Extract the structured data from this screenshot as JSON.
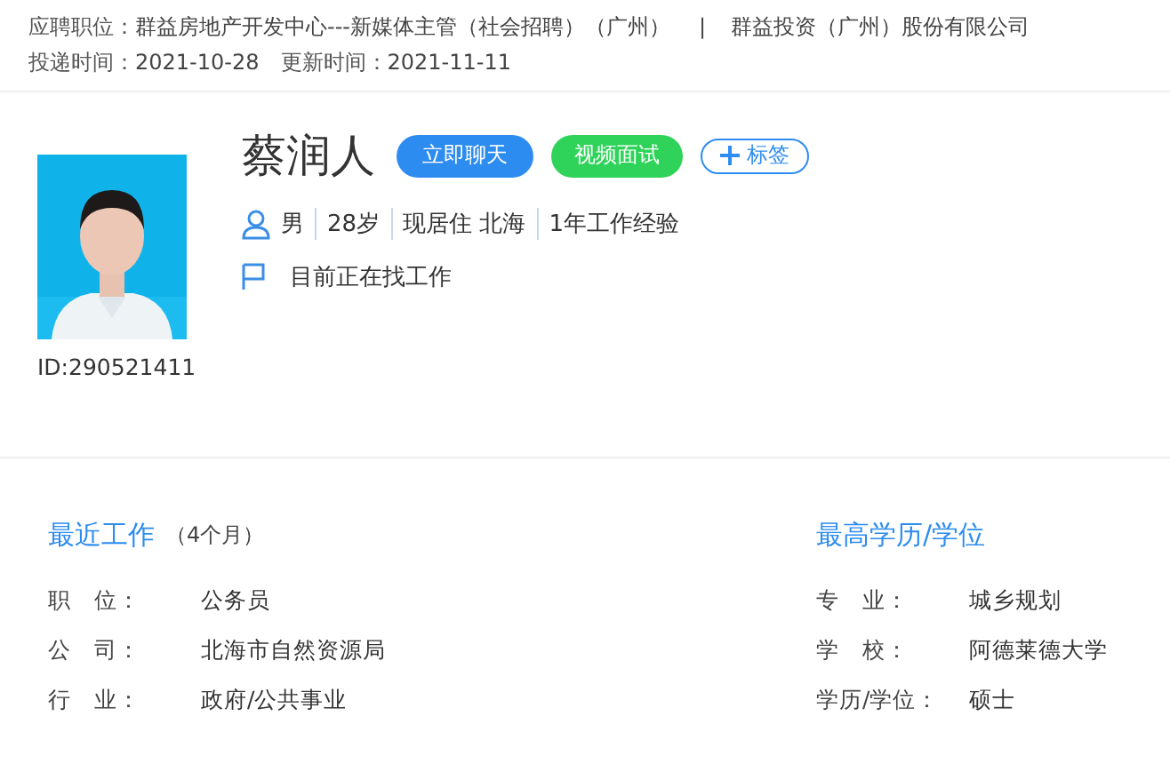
{
  "application": {
    "label": "应聘职位：",
    "position": "群益房地产开发中心---新媒体主管（社会招聘）（广州）",
    "separator": "|",
    "company": "群益投资（广州）股份有限公司"
  },
  "dates": [
    {
      "label": "投递时间：",
      "value": "2021-10-28"
    },
    {
      "label": "更新时间：",
      "value": "2021-11-11"
    }
  ],
  "profile": {
    "id": "ID:290521411",
    "name": "蔡润人",
    "actions": [
      {
        "label": "立即聊天",
        "kind": "chat"
      },
      {
        "label": "视频面试",
        "kind": "video"
      },
      {
        "label": "标签",
        "kind": "tag"
      }
    ],
    "facts": [
      "男",
      "28岁",
      "现居住 北海",
      "1年工作经验"
    ],
    "status": "目前正在找工作"
  },
  "recent_work": {
    "title": "最近工作",
    "duration": "（4个月）",
    "rows": [
      {
        "label": "职　位：",
        "value": "公务员"
      },
      {
        "label": "公　司：",
        "value": "北海市自然资源局"
      },
      {
        "label": "行　业：",
        "value": "政府/公共事业"
      }
    ]
  },
  "education": {
    "title": "最高学历/学位",
    "rows": [
      {
        "label": "专　业：",
        "value": "城乡规划"
      },
      {
        "label": "学　校：",
        "value": "阿德莱德大学"
      },
      {
        "label": "学历/学位：",
        "value": "硕士"
      }
    ]
  }
}
